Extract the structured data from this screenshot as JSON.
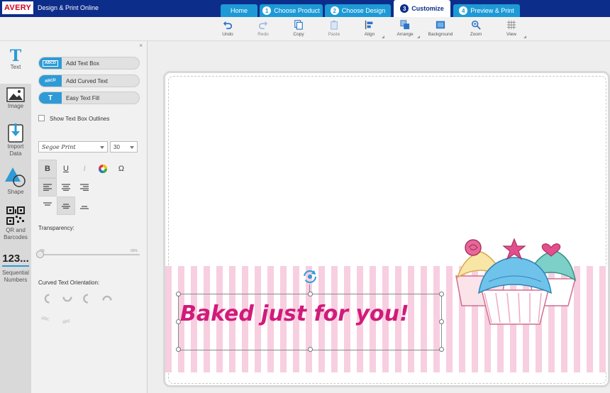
{
  "app": {
    "logo_text": "AVERY",
    "title": "Design & Print Online"
  },
  "tabs": [
    {
      "label": "Home"
    },
    {
      "number": "1",
      "label": "Choose Product"
    },
    {
      "number": "2",
      "label": "Choose Design"
    },
    {
      "number": "3",
      "label": "Customize",
      "active": true
    },
    {
      "number": "4",
      "label": "Preview & Print"
    }
  ],
  "toolbar": {
    "undo": "Undo",
    "redo": "Redo",
    "copy": "Copy",
    "paste": "Paste",
    "align": "Align",
    "arrange": "Arrange",
    "background": "Background",
    "zoom": "Zoom",
    "view": "View"
  },
  "sidebar": {
    "items": [
      {
        "label": "Text",
        "icon": "text-tool-icon",
        "active": true
      },
      {
        "label": "Image",
        "icon": "image-icon"
      },
      {
        "label": "Import\nData",
        "icon": "import-data-icon"
      },
      {
        "label": "Shape",
        "icon": "shape-icon"
      },
      {
        "label": "QR and\nBarcodes",
        "icon": "qr-code-icon"
      },
      {
        "label": "Sequential\nNumbers",
        "icon": "sequential-numbers-icon",
        "glyph": "123..."
      }
    ]
  },
  "panel": {
    "close": "×",
    "add_text_box": {
      "label": "Add Text Box",
      "icon_text": "ABCD"
    },
    "add_curved_text": {
      "label": "Add Curved Text",
      "icon_text": "ABCD"
    },
    "easy_text_fill": {
      "label": "Easy Text Fill",
      "icon_text": "T"
    },
    "show_outlines": {
      "label": "Show Text Box Outlines",
      "checked": false
    },
    "font_family": "Segoe Print",
    "font_size": "30",
    "format": {
      "bold": "B",
      "underline": "U",
      "italic": "I",
      "special_char": "Ω",
      "bold_active": true
    },
    "transparency": {
      "label": "Transparency:",
      "min_label": "0%",
      "max_label": "99%",
      "value": 0
    },
    "curved_orientation": {
      "label": "Curved Text Orientation:",
      "sample_a": "abc",
      "sample_b": "abc"
    }
  },
  "canvas": {
    "text": "Baked just for you!",
    "text_color": "#d11b7a",
    "stripe_color": "#f7cfe0"
  },
  "colors": {
    "topbar": "#0d2d8a",
    "tab": "#1d9ad6",
    "accent_blue": "#2e9bd6"
  }
}
